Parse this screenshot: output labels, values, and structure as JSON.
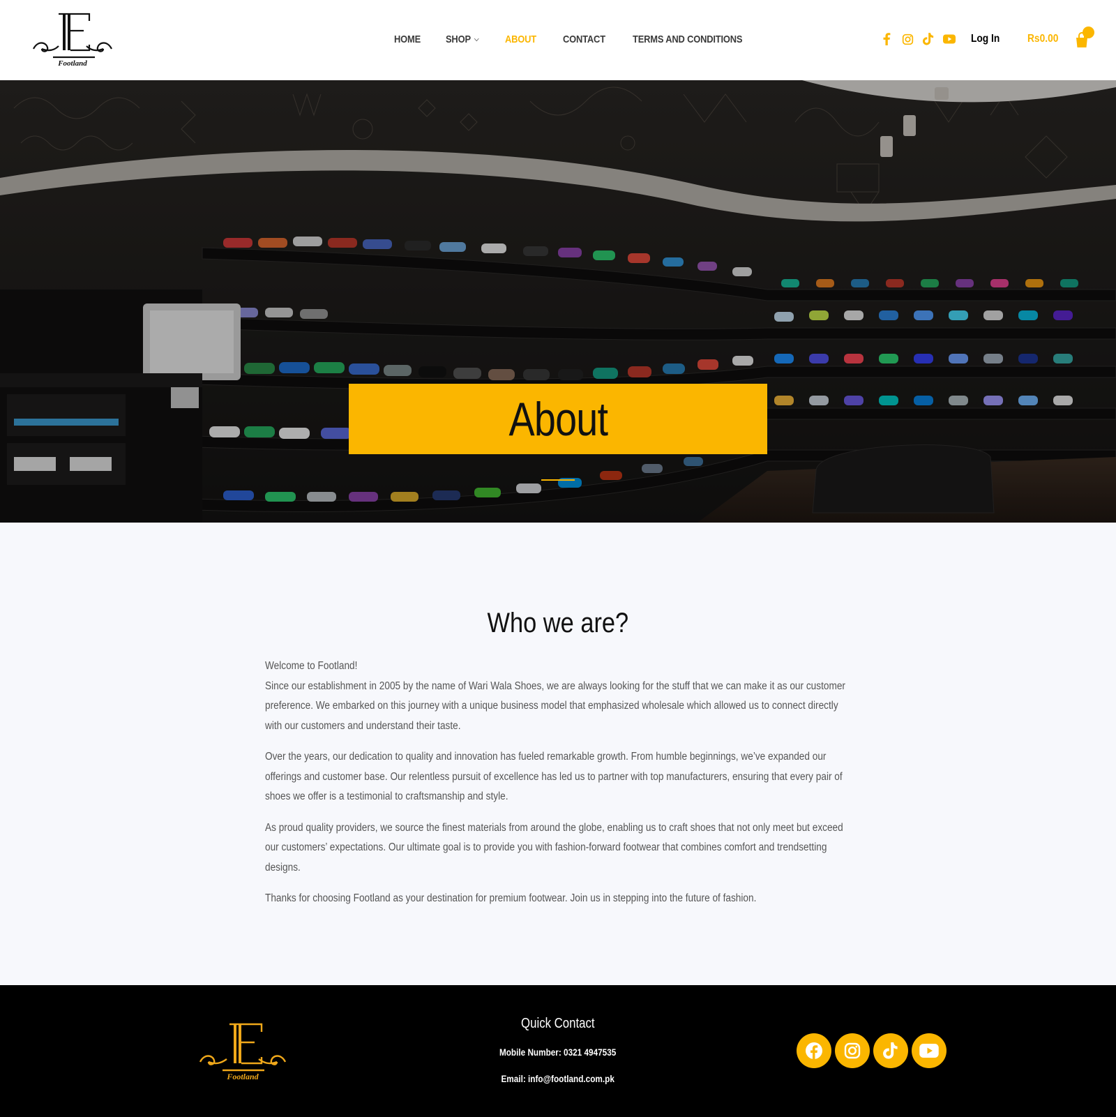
{
  "brand": {
    "name": "Footland"
  },
  "nav": {
    "items": [
      {
        "label": "HOME"
      },
      {
        "label": "SHOP"
      },
      {
        "label": "ABOUT"
      },
      {
        "label": "CONTACT"
      },
      {
        "label": "TERMS AND CONDITIONS"
      }
    ],
    "active": "ABOUT"
  },
  "header": {
    "social_icons": [
      "facebook-icon",
      "instagram-icon",
      "tiktok-icon",
      "youtube-icon"
    ],
    "login_label": "Log In",
    "cart_total": "Rs0.00"
  },
  "hero": {
    "title": "About"
  },
  "about": {
    "heading": "Who we are?",
    "paragraphs": [
      "Welcome to Footland!\nSince our establishment in 2005 by the name of Wari Wala Shoes, we are always looking for the stuff that we can make it as our customer preference. We embarked on this journey with a unique business model that emphasized wholesale which allowed us to connect directly with our customers and understand their taste.",
      "Over the years, our dedication to quality and innovation has fueled remarkable growth. From humble beginnings, we’ve expanded our offerings and customer base. Our relentless pursuit of excellence has led us to partner with top manufacturers, ensuring that every pair of shoes we offer is a testimonial to craftsmanship and style.",
      "As proud quality providers, we source the finest materials from around the globe, enabling us to craft shoes that not only meet but exceed our customers’ expectations. Our ultimate goal is to provide you with fashion-forward footwear that combines comfort and trendsetting designs.",
      "Thanks for choosing Footland as your destination for premium footwear. Join us in stepping into the future of fashion."
    ]
  },
  "footer": {
    "quick_contact_title": "Quick Contact",
    "mobile": "Mobile Number: 0321 4947535",
    "email": "Email: info@footland.com.pk",
    "social_icons": [
      "facebook-icon",
      "instagram-icon",
      "tiktok-icon",
      "youtube-icon"
    ]
  },
  "colors": {
    "accent": "#fbb600",
    "footer_bg": "#000000",
    "content_bg": "#f7f8fc"
  }
}
